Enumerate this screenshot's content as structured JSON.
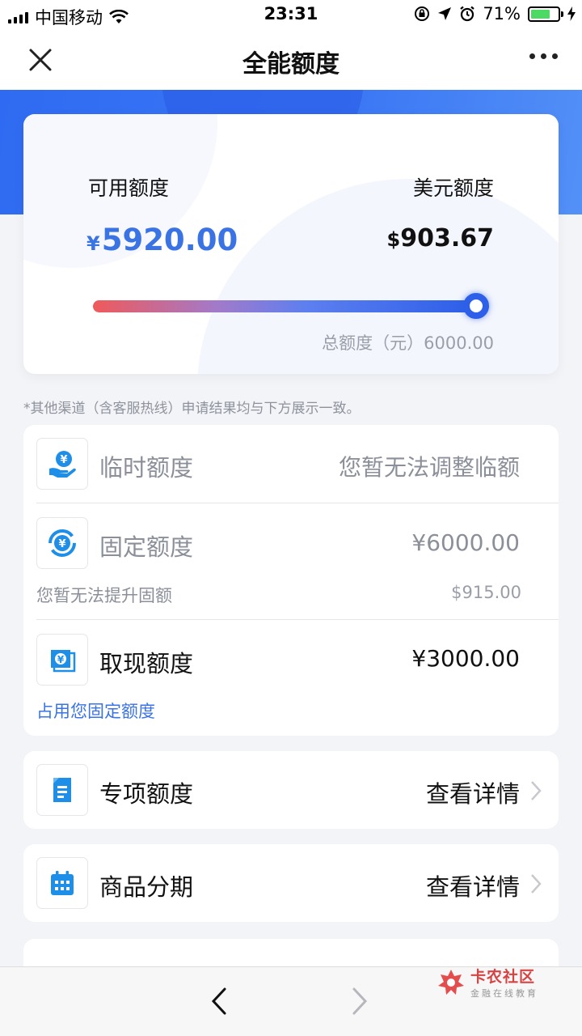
{
  "status_bar": {
    "carrier": "中国移动",
    "time": "23:31",
    "battery_percent": "71%",
    "battery_level": 0.71
  },
  "nav": {
    "title": "全能额度"
  },
  "summary": {
    "available_label": "可用额度",
    "available_currency": "¥",
    "available_amount": "5920.00",
    "usd_label": "美元额度",
    "usd_currency": "$",
    "usd_amount": "903.67",
    "total_text": "总额度（元）6000.00",
    "usage_ratio": 0.9867
  },
  "note": "*其他渠道（含客服热线）申请结果均与下方展示一致。",
  "limits": {
    "temporary": {
      "title": "临时额度",
      "value": "您暂无法调整临额"
    },
    "fixed": {
      "title": "固定额度",
      "value": "¥6000.00",
      "sub_left": "您暂无法提升固额",
      "sub_right": "$915.00"
    },
    "cash": {
      "title": "取现额度",
      "value": "¥3000.00",
      "link": "占用您固定额度"
    }
  },
  "special": {
    "title": "专项额度",
    "detail": "查看详情"
  },
  "installment": {
    "title": "商品分期",
    "detail": "查看详情"
  },
  "watermark": {
    "name": "卡农社区",
    "tagline": "金融在线教育"
  },
  "colors": {
    "primary_blue": "#3a73e4",
    "banner_blue": "#2f6bf2",
    "gradient_start": "#ef5a5a",
    "gradient_end": "#2a5de8"
  }
}
